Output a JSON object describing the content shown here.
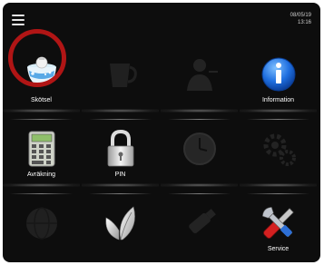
{
  "topbar": {
    "menu_icon": "hamburger-icon",
    "date": "08/05/19",
    "time": "13:16"
  },
  "tiles": [
    {
      "label": "Skötsel",
      "icon": "washing-bowl-icon",
      "active": true,
      "highlight": true
    },
    {
      "label": "",
      "icon": "cup-icon",
      "active": false
    },
    {
      "label": "",
      "icon": "waiter-icon",
      "active": false
    },
    {
      "label": "Information",
      "icon": "info-icon",
      "active": true
    },
    {
      "label": "Avräkning",
      "icon": "calculator-icon",
      "active": true
    },
    {
      "label": "PIN",
      "icon": "padlock-icon",
      "active": true
    },
    {
      "label": "",
      "icon": "clock-icon",
      "active": false
    },
    {
      "label": "",
      "icon": "gears-icon",
      "active": false
    },
    {
      "label": "",
      "icon": "globe-icon",
      "active": false
    },
    {
      "label": "",
      "icon": "leaves-icon",
      "active": true
    },
    {
      "label": "",
      "icon": "usb-stick-icon",
      "active": false
    },
    {
      "label": "Service",
      "icon": "wrench-screwdriver-icon",
      "active": true
    }
  ],
  "colors": {
    "background": "#0d0d0d",
    "highlight_ring": "#b01515",
    "info_blue": "#1f6fe0",
    "screwdriver_red": "#d42020"
  }
}
